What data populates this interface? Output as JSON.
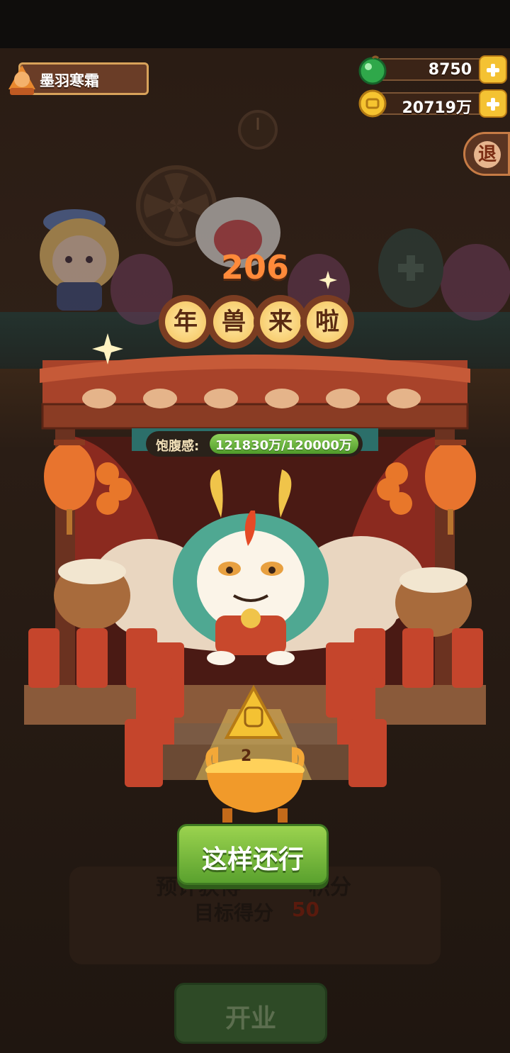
{
  "player": {
    "name": "墨羽寒霜"
  },
  "currencies": {
    "gems": {
      "value": "8750",
      "icon": "green-gem-icon"
    },
    "coins": {
      "value": "20719万",
      "icon": "gold-coin-icon"
    }
  },
  "exit_label": "退",
  "event": {
    "countdown": "206",
    "title_chars": [
      "年",
      "兽",
      "来",
      "啦"
    ]
  },
  "satiety": {
    "label": "饱腹感:",
    "value": "121830万/120000万",
    "fill_fraction": 1.0
  },
  "offering": {
    "count": "2"
  },
  "actions": {
    "confirm_label": "这样还行",
    "open_label": "开业"
  },
  "result": {
    "estimated_score_label": "预计获得",
    "estimated_score_suffix": "积分",
    "target_label": "目标得分",
    "target_value": "50"
  },
  "colors": {
    "accent_orange": "#ff8a3a",
    "green_button": "#7fc043",
    "gold": "#f4c233",
    "wood_red": "#b8492a"
  }
}
